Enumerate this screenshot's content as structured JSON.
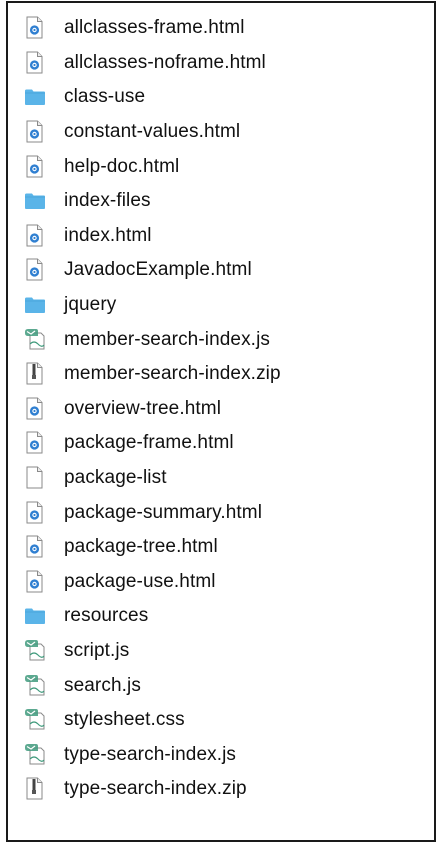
{
  "files": [
    {
      "name": "allclasses-frame.html",
      "icon": "html-file-icon"
    },
    {
      "name": "allclasses-noframe.html",
      "icon": "html-file-icon"
    },
    {
      "name": "class-use",
      "icon": "folder-icon"
    },
    {
      "name": "constant-values.html",
      "icon": "html-file-icon"
    },
    {
      "name": "help-doc.html",
      "icon": "html-file-icon"
    },
    {
      "name": "index-files",
      "icon": "folder-icon"
    },
    {
      "name": "index.html",
      "icon": "html-file-icon"
    },
    {
      "name": "JavadocExample.html",
      "icon": "html-file-icon"
    },
    {
      "name": "jquery",
      "icon": "folder-icon"
    },
    {
      "name": "member-search-index.js",
      "icon": "script-file-icon"
    },
    {
      "name": "member-search-index.zip",
      "icon": "zip-file-icon"
    },
    {
      "name": "overview-tree.html",
      "icon": "html-file-icon"
    },
    {
      "name": "package-frame.html",
      "icon": "html-file-icon"
    },
    {
      "name": "package-list",
      "icon": "blank-file-icon"
    },
    {
      "name": "package-summary.html",
      "icon": "html-file-icon"
    },
    {
      "name": "package-tree.html",
      "icon": "html-file-icon"
    },
    {
      "name": "package-use.html",
      "icon": "html-file-icon"
    },
    {
      "name": "resources",
      "icon": "folder-icon"
    },
    {
      "name": "script.js",
      "icon": "script-file-icon"
    },
    {
      "name": "search.js",
      "icon": "script-file-icon"
    },
    {
      "name": "stylesheet.css",
      "icon": "script-file-icon"
    },
    {
      "name": "type-search-index.js",
      "icon": "script-file-icon"
    },
    {
      "name": "type-search-index.zip",
      "icon": "zip-file-icon"
    }
  ],
  "colors": {
    "folder": "#5ab4e8",
    "folder_tab": "#4aa6dc",
    "html_accent": "#2f7fd1",
    "script_accent": "#3f9a7c",
    "text": "#111111",
    "frame_border": "#1a1a1a"
  }
}
